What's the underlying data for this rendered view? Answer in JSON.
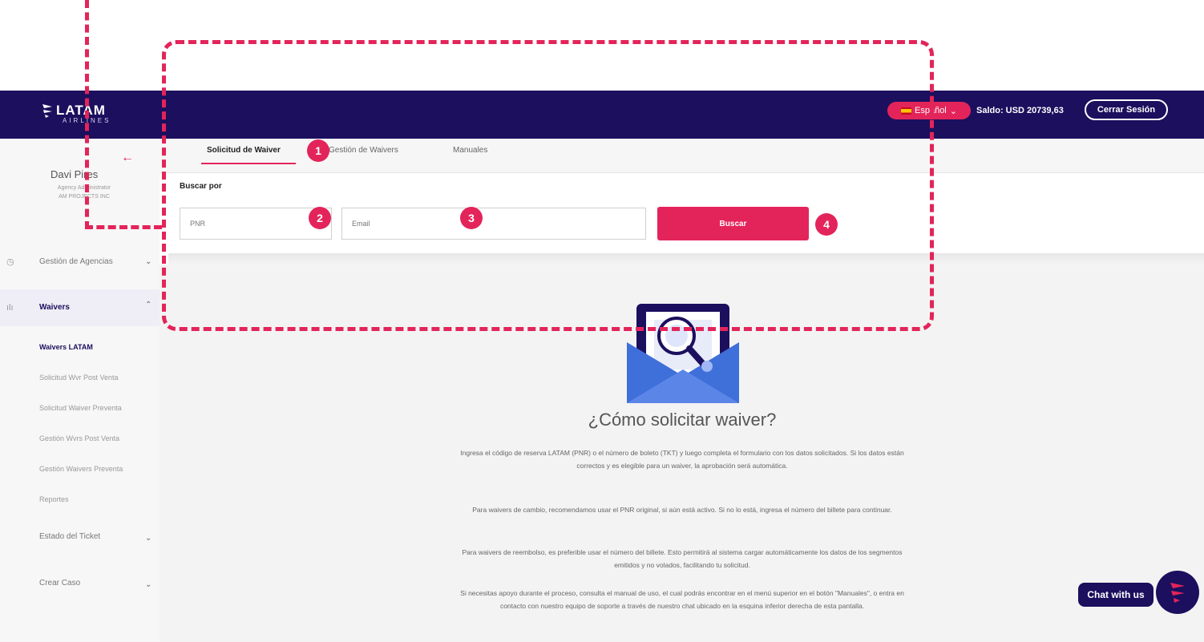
{
  "brand": {
    "name": "LATAM",
    "sub": "AIRLINES"
  },
  "header": {
    "language": "Español",
    "balance": "Saldo: USD 20739,63",
    "logout": "Cerrar Sesión"
  },
  "user": {
    "name": "Davi Pires",
    "role_line1": "Agency Administrator",
    "role_line2": "AM PROJECTS INC"
  },
  "sidebar": {
    "agency_mgmt": "Gestión de Agencias",
    "waivers": "Waivers",
    "submenu": [
      "Waivers LATAM",
      "Solicitud Wvr Post Venta",
      "Solicitud Waiver Preventa",
      "Gestión Wvrs Post Venta",
      "Gestión Waivers Preventa",
      "Reportes"
    ],
    "ticket_status": "Estado del Ticket",
    "create_case": "Crear Caso"
  },
  "tabs": [
    "Solicitud de Waiver",
    "Gestión de Waivers",
    "Manuales"
  ],
  "search": {
    "label": "Buscar por",
    "pnr_placeholder": "PNR",
    "second_placeholder": "Email",
    "button": "Buscar"
  },
  "badges": [
    "1",
    "2",
    "3",
    "4"
  ],
  "content": {
    "title": "¿Cómo solicitar waiver?",
    "p1": "Ingresa el código de reserva LATAM (PNR) o el número de boleto (TKT) y luego completa el formulario con los datos solicitados. Si los datos están correctos y es elegible para un waiver, la aprobación será automática.",
    "p2": "Para waivers de cambio, recomendamos usar el PNR original, si aún está activo. Si no lo está, ingresa el número del billete para continuar.",
    "p3": "Para waivers de reembolso, es preferible usar el número del billete. Esto permitirá al sistema cargar automáticamente los datos de los segmentos emitidos y no volados, facilitando tu solicitud.",
    "p4": "Si necesitas apoyo durante el proceso, consulta el manual de uso, el cual podrás encontrar en el menú superior en el botón \"Manuales\", o entra en contacto con nuestro equipo de soporte a través de nuestro chat ubicado en la esquina inferior derecha de esta pantalla."
  },
  "chat": {
    "label": "Chat with us"
  },
  "colors": {
    "navy": "#1b0f5e",
    "accent": "#e3245a"
  }
}
